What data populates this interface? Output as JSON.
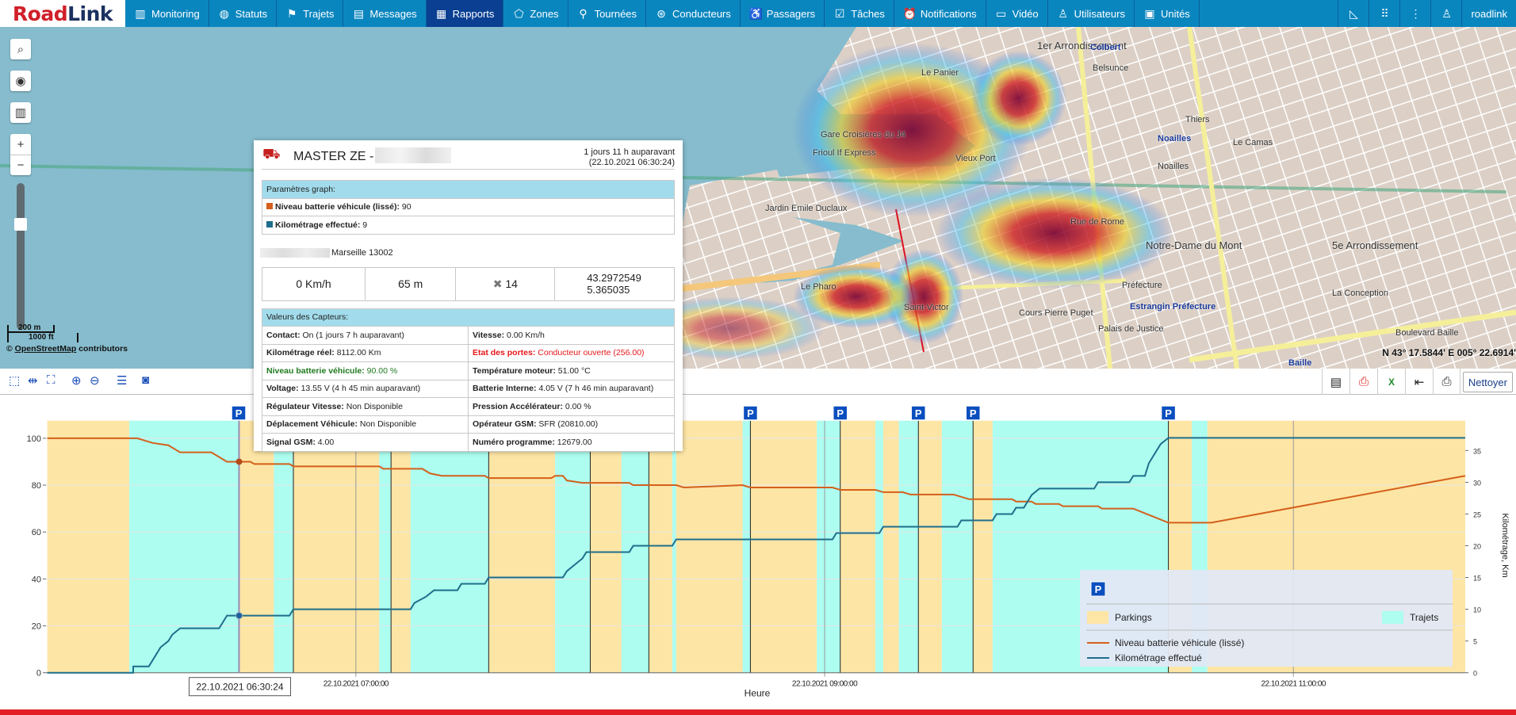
{
  "nav": {
    "logo": "RoadLink",
    "logo_parts": [
      "Road",
      "Link"
    ],
    "items": [
      {
        "label": "Monitoring",
        "icon": "bar-chart-icon"
      },
      {
        "label": "Statuts",
        "icon": "globe-icon"
      },
      {
        "label": "Trajets",
        "icon": "checkered-flag-icon"
      },
      {
        "label": "Messages",
        "icon": "document-icon"
      },
      {
        "label": "Rapports",
        "icon": "report-icon",
        "active": true
      },
      {
        "label": "Zones",
        "icon": "polygon-icon"
      },
      {
        "label": "Tournées",
        "icon": "route-pin-icon"
      },
      {
        "label": "Conducteurs",
        "icon": "steering-wheel-icon"
      },
      {
        "label": "Passagers",
        "icon": "passenger-seat-icon"
      },
      {
        "label": "Tâches",
        "icon": "clipboard-check-icon"
      },
      {
        "label": "Notifications",
        "icon": "alarm-clock-icon"
      },
      {
        "label": "Vidéo",
        "icon": "video-camera-icon"
      },
      {
        "label": "Utilisateurs",
        "icon": "user-icon"
      },
      {
        "label": "Unités",
        "icon": "bus-icon"
      }
    ],
    "right": {
      "ruler_icon": "ruler-triangle-icon",
      "apps_icon": "grid-icon",
      "more_icon": "more-vertical-icon",
      "user_icon": "user-icon",
      "username": "roadlink"
    }
  },
  "map": {
    "controls": [
      "search-icon",
      "eye-icon",
      "map-layers-icon",
      "zoom-in-icon",
      "zoom-out-icon"
    ],
    "zoom_level": 0.3,
    "scale_metric": "200 m",
    "scale_imperial": "1000 ft",
    "attribution_prefix": "© ",
    "attribution_link": "OpenStreetMap",
    "attribution_suffix": " contributors",
    "coords": "N 43° 17.5844' E 005° 22.6914'",
    "labels": [
      {
        "text": "1er Arrondissement",
        "cls": "big"
      },
      {
        "text": "Colbert",
        "cls": "blue"
      },
      {
        "text": "Belsunce",
        "cls": ""
      },
      {
        "text": "Le Panier",
        "cls": ""
      },
      {
        "text": "Thiers",
        "cls": ""
      },
      {
        "text": "Noailles",
        "cls": "blue"
      },
      {
        "text": "Noailles",
        "cls": ""
      },
      {
        "text": "Le Camas",
        "cls": ""
      },
      {
        "text": "Notre-Dame du Mont",
        "cls": "big"
      },
      {
        "text": "5e Arrondissement",
        "cls": "big"
      },
      {
        "text": "La Conception",
        "cls": ""
      },
      {
        "text": "Préfecture",
        "cls": ""
      },
      {
        "text": "Estrangin Préfecture",
        "cls": "blue"
      },
      {
        "text": "Palais de Justice",
        "cls": ""
      },
      {
        "text": "Saint-Victor",
        "cls": ""
      },
      {
        "text": "Cours Pierre Puget",
        "cls": ""
      },
      {
        "text": "Le Pharo",
        "cls": ""
      },
      {
        "text": "Jardin Emile Duclaux",
        "cls": ""
      },
      {
        "text": "Gare Croisières du J4",
        "cls": ""
      },
      {
        "text": "Frioul If Express",
        "cls": ""
      },
      {
        "text": "Vieux Port",
        "cls": ""
      },
      {
        "text": "Baille",
        "cls": "blue"
      },
      {
        "text": "Boulevard Baille",
        "cls": ""
      },
      {
        "text": "Rue de Rome",
        "cls": ""
      }
    ]
  },
  "toolbar": {
    "left_icons": [
      "zoom-select-icon",
      "zoom-x-icon",
      "zoom-fit-icon",
      "zoom-in-icon",
      "zoom-out-icon",
      "legend-list-icon",
      "screenshot-icon"
    ],
    "right_icons": [
      "columns-icon",
      "pdf-icon",
      "excel-icon",
      "import-icon",
      "print-icon"
    ],
    "clear_label": "Nettoyer"
  },
  "popup": {
    "title": "MASTER ZE -",
    "ago": "1 jours 11 h auparavant",
    "datetime": "(22.10.2021 06:30:24)",
    "graph_header": "Paramètres graph:",
    "graph_params": [
      {
        "label": "Niveau batterie véhicule (lissé):",
        "value": " 90",
        "color": "#d4601c"
      },
      {
        "label": "Kilométrage effectué:",
        "value": " 9",
        "color": "#1e6e8c"
      }
    ],
    "address": "Marseille 13002",
    "stats": {
      "speed": "0 Km/h",
      "altitude": "65 m",
      "satellites": "14",
      "lat": "43.2972549",
      "lon": "5.365035"
    },
    "sensors_header": "Valeurs des Capteurs:",
    "sensors": [
      [
        {
          "label": "Contact:",
          "value": " On (1 jours 7 h auparavant)",
          "color": "#222"
        },
        {
          "label": "Vitesse:",
          "value": " 0.00 Km/h",
          "color": "#222"
        }
      ],
      [
        {
          "label": "Kilométrage réel:",
          "value": " 8112.00 Km",
          "color": "#222"
        },
        {
          "label": "Etat des portes:",
          "value": " Conducteur ouverte (256.00)",
          "color": "#e8161b"
        }
      ],
      [
        {
          "label": "Niveau batterie véhicule:",
          "value": " 90.00 %",
          "color": "#1f7a1f"
        },
        {
          "label": "Température moteur:",
          "value": " 51.00 °C",
          "color": "#222"
        }
      ],
      [
        {
          "label": "Voltage:",
          "value": " 13.55 V (4 h 45 min  auparavant)",
          "color": "#222"
        },
        {
          "label": "Batterie Interne:",
          "value": " 4.05 V (7 h 46 min  auparavant)",
          "color": "#222"
        }
      ],
      [
        {
          "label": "Régulateur Vitesse:",
          "value": " Non Disponible",
          "color": "#222"
        },
        {
          "label": "Pression Accélérateur:",
          "value": " 0.00 %",
          "color": "#222"
        }
      ],
      [
        {
          "label": "Déplacement Véhicule:",
          "value": " Non Disponible",
          "color": "#222"
        },
        {
          "label": "Opérateur GSM:",
          "value": " SFR (20810.00)",
          "color": "#222"
        }
      ],
      [
        {
          "label": "Signal GSM:",
          "value": " 4.00",
          "color": "#222"
        },
        {
          "label": "Numéro programme:",
          "value": " 12679.00",
          "color": "#222"
        }
      ]
    ]
  },
  "chart_data": {
    "type": "line",
    "xlabel": "Heure",
    "ylabel_right": "Kilométrage, Km",
    "x_range": [
      "05:41",
      "11:44"
    ],
    "x_ticks": [
      {
        "t": "07:00",
        "label": "22.10.2021 07:00:00"
      },
      {
        "t": "09:00",
        "label": "22.10.2021 09:00:00"
      },
      {
        "t": "11:00",
        "label": "22.10.2021 11:00:00"
      }
    ],
    "ylim_left": [
      0,
      107.5
    ],
    "yticks_left": [
      0,
      20,
      40,
      60,
      80,
      100
    ],
    "ylim_right": [
      0,
      39.7
    ],
    "yticks_right": [
      0,
      5,
      10,
      15,
      20,
      25,
      30,
      35
    ],
    "grid": true,
    "colors": {
      "parking": "#fde5a5",
      "trip": "#adfdf0",
      "battery": "#d4601c",
      "km": "#1e6e8c",
      "parking_marker": "#0a4fbf"
    },
    "bands": [
      {
        "type": "parking",
        "start": "05:41",
        "end": "06:02"
      },
      {
        "type": "trip",
        "start": "06:02",
        "end": "06:30"
      },
      {
        "type": "parking",
        "start": "06:30",
        "end": "06:39"
      },
      {
        "type": "trip",
        "start": "06:39",
        "end": "06:44"
      },
      {
        "type": "parking",
        "start": "06:44",
        "end": "07:06"
      },
      {
        "type": "trip",
        "start": "07:06",
        "end": "07:09"
      },
      {
        "type": "parking",
        "start": "07:09",
        "end": "07:14"
      },
      {
        "type": "trip",
        "start": "07:14",
        "end": "07:34"
      },
      {
        "type": "parking",
        "start": "07:34",
        "end": "07:51"
      },
      {
        "type": "trip",
        "start": "07:51",
        "end": "08:00"
      },
      {
        "type": "parking",
        "start": "08:00",
        "end": "08:08"
      },
      {
        "type": "trip",
        "start": "08:08",
        "end": "08:15"
      },
      {
        "type": "parking",
        "start": "08:15",
        "end": "08:21"
      },
      {
        "type": "trip",
        "start": "08:21",
        "end": "08:22"
      },
      {
        "type": "parking",
        "start": "08:22",
        "end": "08:39"
      },
      {
        "type": "trip",
        "start": "08:39",
        "end": "08:41"
      },
      {
        "type": "parking",
        "start": "08:41",
        "end": "08:58"
      },
      {
        "type": "trip",
        "start": "08:58",
        "end": "09:04"
      },
      {
        "type": "parking",
        "start": "09:04",
        "end": "09:13"
      },
      {
        "type": "trip",
        "start": "09:13",
        "end": "09:15"
      },
      {
        "type": "parking",
        "start": "09:15",
        "end": "09:19"
      },
      {
        "type": "trip",
        "start": "09:19",
        "end": "09:24"
      },
      {
        "type": "parking",
        "start": "09:24",
        "end": "09:30"
      },
      {
        "type": "trip",
        "start": "09:30",
        "end": "09:38"
      },
      {
        "type": "parking",
        "start": "09:38",
        "end": "09:43"
      },
      {
        "type": "trip",
        "start": "09:43",
        "end": "10:28"
      },
      {
        "type": "parking",
        "start": "10:28",
        "end": "10:34"
      },
      {
        "type": "trip",
        "start": "10:34",
        "end": "10:38"
      },
      {
        "type": "parking",
        "start": "10:38",
        "end": "11:44"
      }
    ],
    "stop_lines": [
      "06:30",
      "06:44",
      "07:09",
      "07:34",
      "08:00",
      "08:15",
      "08:41",
      "09:04",
      "09:24",
      "09:38",
      "10:28"
    ],
    "parking_markers": [
      {
        "t": "06:30",
        "label": "P"
      },
      {
        "t": "08:41",
        "label": "P"
      },
      {
        "t": "09:04",
        "label": "P"
      },
      {
        "t": "09:24",
        "label": "P"
      },
      {
        "t": "09:38",
        "label": "P"
      },
      {
        "t": "10:28",
        "label": "P"
      }
    ],
    "series": [
      {
        "name": "Niveau batterie véhicule (lissé)",
        "axis": "left",
        "points": [
          [
            "05:41",
            100
          ],
          [
            "06:04",
            100
          ],
          [
            "06:06",
            99
          ],
          [
            "06:08",
            98
          ],
          [
            "06:12",
            97
          ],
          [
            "06:14",
            95
          ],
          [
            "06:15",
            94
          ],
          [
            "06:23",
            94
          ],
          [
            "06:27",
            90
          ],
          [
            "06:33",
            90
          ],
          [
            "06:34",
            89
          ],
          [
            "06:43",
            89
          ],
          [
            "06:44",
            88
          ],
          [
            "07:06",
            88
          ],
          [
            "07:07",
            87
          ],
          [
            "07:17",
            87
          ],
          [
            "07:19",
            85
          ],
          [
            "07:22",
            84
          ],
          [
            "07:33",
            84
          ],
          [
            "07:34",
            83
          ],
          [
            "07:50",
            83
          ],
          [
            "07:51",
            84
          ],
          [
            "07:53",
            84
          ],
          [
            "07:54",
            82
          ],
          [
            "07:58",
            81
          ],
          [
            "08:10",
            81
          ],
          [
            "08:11",
            80
          ],
          [
            "08:22",
            80
          ],
          [
            "08:24",
            79
          ],
          [
            "08:39",
            80
          ],
          [
            "08:41",
            79
          ],
          [
            "09:02",
            79
          ],
          [
            "09:04",
            78
          ],
          [
            "09:13",
            78
          ],
          [
            "09:15",
            77
          ],
          [
            "09:20",
            77
          ],
          [
            "09:22",
            76
          ],
          [
            "09:33",
            76
          ],
          [
            "09:35",
            75
          ],
          [
            "09:37",
            74
          ],
          [
            "09:48",
            74
          ],
          [
            "09:49",
            73
          ],
          [
            "09:53",
            73
          ],
          [
            "09:54",
            72
          ],
          [
            "10:00",
            72
          ],
          [
            "10:01",
            71
          ],
          [
            "10:10",
            71
          ],
          [
            "10:11",
            70
          ],
          [
            "10:19",
            70
          ],
          [
            "10:22",
            68
          ],
          [
            "10:25",
            66
          ],
          [
            "10:28",
            64
          ],
          [
            "10:39",
            64
          ],
          [
            "11:44",
            84
          ]
        ]
      },
      {
        "name": "Kilométrage effectué",
        "axis": "right",
        "points": [
          [
            "05:41",
            0
          ],
          [
            "06:03",
            0
          ],
          [
            "06:03",
            1
          ],
          [
            "06:07",
            1
          ],
          [
            "06:08",
            2
          ],
          [
            "06:09",
            3
          ],
          [
            "06:10",
            4
          ],
          [
            "06:12",
            5
          ],
          [
            "06:13",
            6
          ],
          [
            "06:15",
            7
          ],
          [
            "06:25",
            7
          ],
          [
            "06:26",
            8
          ],
          [
            "06:27",
            9
          ],
          [
            "06:43",
            9
          ],
          [
            "06:44",
            10
          ],
          [
            "07:14",
            10
          ],
          [
            "07:15",
            11
          ],
          [
            "07:18",
            12
          ],
          [
            "07:20",
            13
          ],
          [
            "07:26",
            13
          ],
          [
            "07:27",
            14
          ],
          [
            "07:33",
            14
          ],
          [
            "07:34",
            15
          ],
          [
            "07:53",
            15
          ],
          [
            "07:54",
            16
          ],
          [
            "07:56",
            17
          ],
          [
            "07:58",
            18
          ],
          [
            "07:59",
            19
          ],
          [
            "08:10",
            19
          ],
          [
            "08:11",
            20
          ],
          [
            "08:21",
            20
          ],
          [
            "08:22",
            21
          ],
          [
            "09:02",
            21
          ],
          [
            "09:03",
            22
          ],
          [
            "09:14",
            22
          ],
          [
            "09:15",
            23
          ],
          [
            "09:34",
            23
          ],
          [
            "09:35",
            24
          ],
          [
            "09:43",
            24
          ],
          [
            "09:44",
            25
          ],
          [
            "09:48",
            25
          ],
          [
            "09:49",
            26
          ],
          [
            "09:51",
            26
          ],
          [
            "09:53",
            28
          ],
          [
            "09:55",
            29
          ],
          [
            "10:09",
            29
          ],
          [
            "10:10",
            30
          ],
          [
            "10:18",
            30
          ],
          [
            "10:19",
            31
          ],
          [
            "10:22",
            31
          ],
          [
            "10:23",
            33
          ],
          [
            "10:25",
            35
          ],
          [
            "10:26",
            36
          ],
          [
            "10:28",
            37
          ],
          [
            "11:44",
            37
          ]
        ]
      }
    ],
    "cursor": {
      "t": "06:30",
      "label": "22.10.2021 06:30:24",
      "battery": 90,
      "km": 9
    },
    "legend": {
      "placement": "bottom-right",
      "marker_label": "P",
      "parking_label": "Parkings",
      "trip_label": "Trajets",
      "battery_label": "Niveau batterie véhicule (lissé)",
      "km_label": "Kilométrage effectué"
    }
  }
}
